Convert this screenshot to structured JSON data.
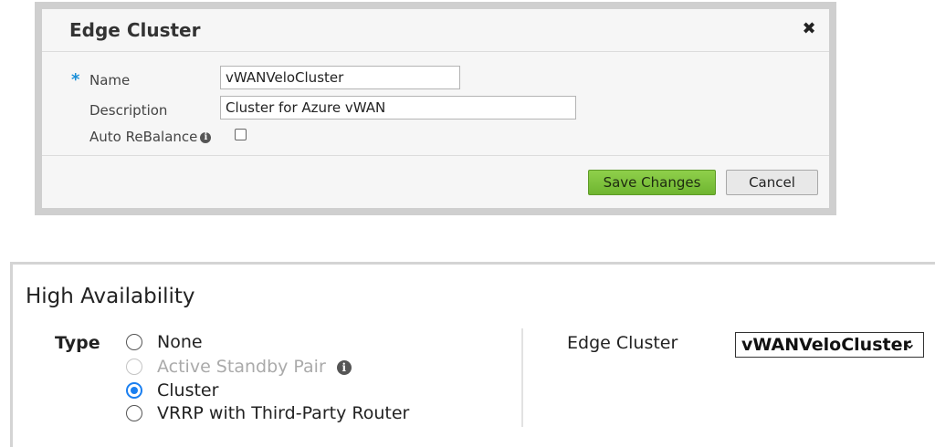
{
  "dialog": {
    "title": "Edge Cluster",
    "close_icon": "close-icon",
    "fields": {
      "name": {
        "required_marker": "*",
        "label": "Name",
        "value": "vWANVeloCluster"
      },
      "description": {
        "label": "Description",
        "value": "Cluster for Azure vWAN"
      },
      "auto_rebalance": {
        "label": "Auto ReBalance",
        "icon": "info-icon",
        "checked": false
      }
    },
    "buttons": {
      "save": "Save Changes",
      "cancel": "Cancel"
    },
    "colors": {
      "save_button": "#7cc23a",
      "required_star": "#1a8fd8"
    }
  },
  "high_availability": {
    "title": "High Availability",
    "type_label": "Type",
    "options": [
      {
        "label": "None",
        "state": "unselected"
      },
      {
        "label": "Active Standby Pair",
        "state": "disabled",
        "icon": "info-icon"
      },
      {
        "label": "Cluster",
        "state": "selected"
      },
      {
        "label": "VRRP with Third-Party Router",
        "state": "unselected"
      }
    ],
    "edge_cluster_label": "Edge Cluster",
    "edge_cluster_value": "vWANVeloCluster",
    "colors": {
      "selected_radio": "#1a7ff0"
    }
  }
}
